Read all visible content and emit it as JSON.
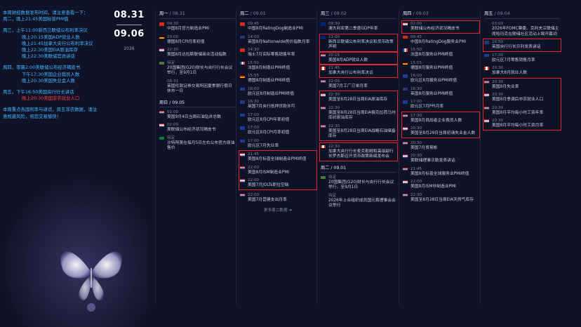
{
  "notes": [
    {
      "lines": [
        {
          "text": "本周财经数据发布时间，请注意查看一下：",
          "red": false
        },
        {
          "text": "周二，晚上21:45美国标普PMI值",
          "red": false
        }
      ]
    },
    {
      "lines": [
        {
          "text": "周三，上午11:00新西兰联储公布利率决议",
          "red": false
        },
        {
          "text": "晚上20:15美国ADP就业人数",
          "red": false,
          "indent": true
        },
        {
          "text": "晚上21:45加拿大央行公布利率决议",
          "red": false,
          "indent": true
        },
        {
          "text": "晚上22:30美国EIA原油库存",
          "red": false,
          "indent": true
        },
        {
          "text": "晚上22:30美联储官员讲话",
          "red": false,
          "indent": true
        }
      ]
    },
    {
      "lines": [
        {
          "text": "周四，零晨2:00美联储公布经济褐皮书",
          "red": false
        },
        {
          "text": "下午17:30美国企业裁员人数",
          "red": false,
          "indent": true
        },
        {
          "text": "晚上20:30美国失业金人数",
          "red": false,
          "indent": true
        }
      ]
    },
    {
      "lines": [
        {
          "text": "周五，下午16:50美国央行行长讲话",
          "red": false
        },
        {
          "text": "晚上20:30美国非农就业人口",
          "red": true,
          "indent": true
        }
      ]
    },
    {
      "lines": [
        {
          "text": "本周重点各国利率与讲话，周五非农数据，请注",
          "red": false
        },
        {
          "text": "意规避风险，祝您交易愉快！",
          "red": false
        }
      ]
    }
  ],
  "dates": {
    "start": "08.31",
    "end": "09.06",
    "year": "2026"
  },
  "columns": [
    {
      "days": [
        {
          "title": "周一",
          "date": "08.31",
          "events": [
            {
              "time": "09:30",
              "flag": "cn",
              "text": "中国8月官方制造业PMI",
              "boxed": false
            },
            {
              "time": "20:00",
              "flag": "de",
              "text": "德国8月CPI月率初值",
              "boxed": false
            },
            {
              "time": "22:30",
              "flag": "us",
              "text": "美国8月达拉斯联储商业活动指数",
              "boxed": false
            },
            {
              "time": "待定",
              "flag": "gl",
              "text": "20国集团(G20)财长与央行行长会议举行，至9月1日",
              "boxed": false
            },
            {
              "time": "08-31",
              "flag": "",
              "text": "英国伦敦证券交易所因夏季银行假日休市一日",
              "boxed": false
            }
          ]
        },
        {
          "title": "周日",
          "date": "09.05",
          "events": [
            {
              "time": "01:00",
              "flag": "us",
              "text": "美国9月4日当周石油钻井总数",
              "boxed": false
            },
            {
              "time": "02:00",
              "flag": "us",
              "text": "美联储公布经济状况褐皮书",
              "boxed": false
            },
            {
              "time": "待定",
              "flag": "sa",
              "text": "沙特阿美在每月5日左右公布官方原油售价",
              "boxed": false
            }
          ]
        }
      ]
    },
    {
      "days": [
        {
          "title": "周二",
          "date": "09.01",
          "events": [
            {
              "time": "09:45",
              "flag": "cn",
              "text": "中国8月RatingDog制造业PMI",
              "boxed": false
            },
            {
              "time": "14:00",
              "flag": "uk",
              "text": "英国8月Nationwide房价指数月率",
              "boxed": false
            },
            {
              "time": "14:30",
              "flag": "ch",
              "text": "瑞士7月实际零售销售年率",
              "boxed": false
            },
            {
              "time": "15:50",
              "flag": "fr",
              "text": "法国8月制造业PMI终值",
              "boxed": false
            },
            {
              "time": "15:55",
              "flag": "de",
              "text": "德国8月制造业PMI终值",
              "boxed": false
            },
            {
              "time": "16:00",
              "flag": "eu",
              "text": "欧元区8月制造业PMI终值",
              "boxed": false
            },
            {
              "time": "16:30",
              "flag": "uk",
              "text": "英国7月央行抵押贷款许可",
              "boxed": false
            },
            {
              "time": "17:00",
              "flag": "eu",
              "text": "欧元区8月CPI年率初值",
              "boxed": false
            },
            {
              "time": "17:00",
              "flag": "eu",
              "text": "欧元区8月CPI月率初值",
              "boxed": false
            },
            {
              "time": "17:00",
              "flag": "eu",
              "text": "欧元区7月失业率",
              "boxed": false
            }
          ],
          "group": [
            {
              "time": "21:45",
              "flag": "us",
              "text": "美国8月标普全球制造业PMI终值"
            },
            {
              "time": "22:00",
              "flag": "us",
              "text": "美国8月ISM制造业PMI"
            },
            {
              "time": "22:00",
              "flag": "us",
              "text": "美国7月JOLTs职位空缺"
            }
          ],
          "after": [
            {
              "time": "22:00",
              "flag": "us",
              "text": "美国7月营建支出月率",
              "boxed": false
            }
          ],
          "more": "更多周二数据 ➜"
        }
      ]
    },
    {
      "days": [
        {
          "title": "周三",
          "date": "09.02",
          "events": [
            {
              "time": "09:30",
              "flag": "au",
              "text": "澳大利亚第二季度GDP年率",
              "boxed": false
            },
            {
              "time": "11:00",
              "flag": "au",
              "text": "新西兰联储公布利率决议和货币政策声明",
              "boxed": true
            },
            {
              "time": "20:15",
              "flag": "us",
              "text": "美国8月ADP就业人数",
              "boxed": true
            },
            {
              "time": "21:45",
              "flag": "ca",
              "text": "加拿大央行公布利率决议",
              "boxed": true
            },
            {
              "time": "22:00",
              "flag": "us",
              "text": "美国7月工厂订单月率",
              "boxed": false
            }
          ],
          "group": [
            {
              "time": "22:30",
              "flag": "us",
              "text": "美国至8月28日当周EIA原油库存"
            },
            {
              "time": "22:30",
              "flag": "us",
              "text": "美国至8月28日当周EIA俄克拉荷马州库欣原油库存"
            },
            {
              "time": "22:30",
              "flag": "us",
              "text": "美国至8月28日当周EIA战略石油储备库存"
            }
          ],
          "group2": [
            {
              "time": "22:30",
              "flag": "ca",
              "text": "加拿大央行行长麦克勒姆和高级副行长罗杰斯召开货币政策新闻发布会"
            }
          ]
        },
        {
          "title": "周二",
          "date": "09.01",
          "events": [
            {
              "time": "待定",
              "flag": "gl",
              "text": "20国集团(G20)财长与央行行长会议举行，至9月1日",
              "boxed": false
            },
            {
              "time": "待定",
              "flag": "",
              "text": "2026年上合组织成员国元首理事会会议举行",
              "boxed": false
            }
          ]
        }
      ]
    },
    {
      "days": [
        {
          "title": "周四",
          "date": "09.03",
          "events": [
            {
              "time": "02:00",
              "flag": "us",
              "text": "美联储公布经济状况褐皮书",
              "boxed": true
            },
            {
              "time": "09:45",
              "flag": "cn",
              "text": "中国8月RatingDog服务业PMI",
              "boxed": false
            },
            {
              "time": "15:50",
              "flag": "fr",
              "text": "法国8月服务业PMI终值",
              "boxed": false
            },
            {
              "time": "15:55",
              "flag": "de",
              "text": "德国8月服务业PMI终值",
              "boxed": false
            },
            {
              "time": "16:00",
              "flag": "eu",
              "text": "欧元区8月服务业PMI终值",
              "boxed": false
            },
            {
              "time": "16:30",
              "flag": "uk",
              "text": "英国8月服务业PMI终值",
              "boxed": false
            },
            {
              "time": "17:00",
              "flag": "eu",
              "text": "欧元区7月PPI月率",
              "boxed": false
            }
          ],
          "group": [
            {
              "time": "17:30",
              "flag": "us",
              "text": "美国8月挑战者企业裁员人数"
            },
            {
              "time": "20:30",
              "flag": "us",
              "text": "美国至8月29日当周初请失业金人数"
            }
          ],
          "after": [
            {
              "time": "20:30",
              "flag": "us",
              "text": "美国7月贸易帐",
              "boxed": false
            },
            {
              "time": "20:30",
              "flag": "us",
              "text": "美联储理事沃勒发表讲话",
              "boxed": false
            },
            {
              "time": "21:45",
              "flag": "us",
              "text": "美国8月标普全球服务业PMI终值",
              "boxed": false
            },
            {
              "time": "22:00",
              "flag": "us",
              "text": "美国8月ISM非制造业PMI",
              "boxed": false
            },
            {
              "time": "22:30",
              "flag": "us",
              "text": "美国至8月28日当周EIA天然气库存",
              "boxed": false
            }
          ]
        }
      ]
    },
    {
      "days": [
        {
          "title": "周五",
          "date": "09.04",
          "events": [
            {
              "time": "03:00",
              "flag": "",
              "text": "2026年FOMC票委、克利夫兰联储主席哈玛克在联储社区活动上致开幕词",
              "boxed": false
            },
            {
              "time": "16:50",
              "flag": "uk",
              "text": "英国央行行长贝利发表讲话",
              "boxed": true
            },
            {
              "time": "17:00",
              "flag": "eu",
              "text": "欧元区7月零售销售月率",
              "boxed": false
            },
            {
              "time": "20:30",
              "flag": "ca",
              "text": "加拿大8月就业人数",
              "boxed": false
            }
          ],
          "group": [
            {
              "time": "20:30",
              "flag": "us",
              "text": "美国8月失业率"
            },
            {
              "time": "20:30",
              "flag": "us",
              "text": "美国8月季调后非农就业人口"
            },
            {
              "time": "20:30",
              "flag": "us",
              "text": "美国8月平均每小时工资年率"
            },
            {
              "time": "20:30",
              "flag": "us",
              "text": "美国8月平均每小时工资月率"
            }
          ]
        }
      ]
    }
  ]
}
